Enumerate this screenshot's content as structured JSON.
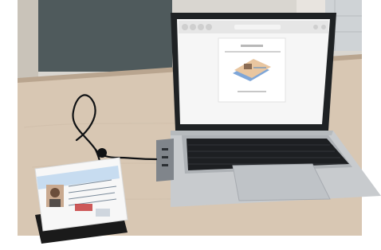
{
  "photo": {
    "colors": {
      "frame": "#ffffff",
      "wall_dark": "#4f5a5c",
      "wall_light": "#d9d6d0",
      "window_frame": "#cfd3d6",
      "table_top": "#d8c7b3",
      "table_edge": "#b9a58f",
      "laptop_body": "#c8cbce",
      "keyboard_deck": "#aeb2b6",
      "keys": "#1d1f22",
      "screen_bg": "#f6f6f6",
      "hub_body": "#80858b",
      "card_blue": "#c7dcf0",
      "card_white": "#f7f7f7",
      "reader_black": "#1a1a1a"
    }
  }
}
